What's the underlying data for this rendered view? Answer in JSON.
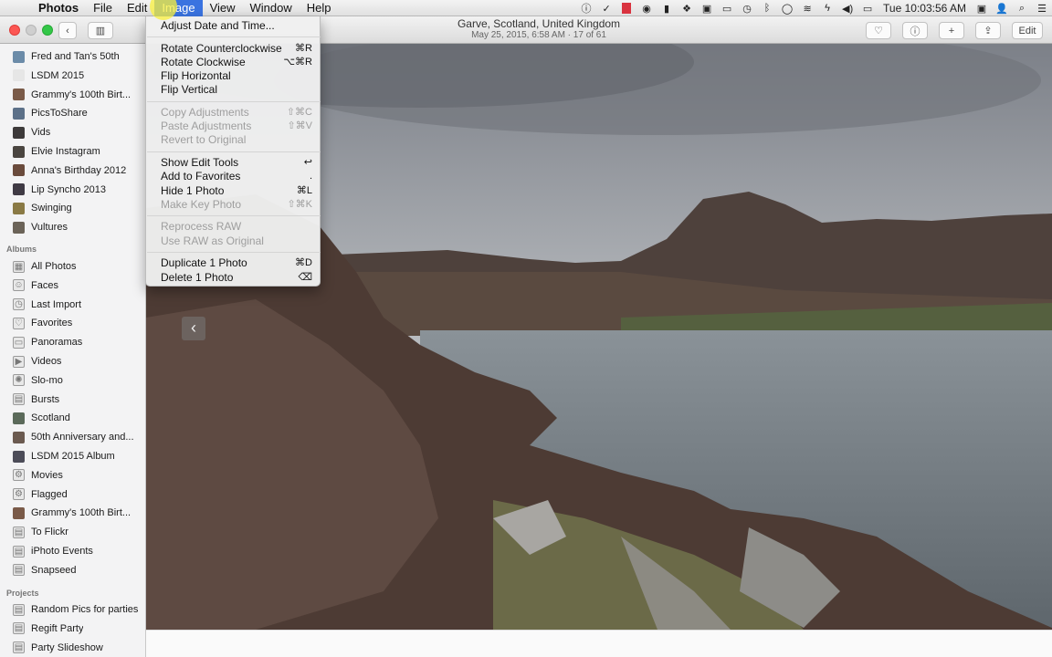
{
  "menubar": {
    "app": "Photos",
    "menus": [
      "File",
      "Edit",
      "Image",
      "View",
      "Window",
      "Help"
    ],
    "active_menu": "Image",
    "clock": "Tue 10:03:56 AM"
  },
  "window": {
    "title": "Garve, Scotland, United Kingdom",
    "subtitle": "May 25, 2015, 6:58 AM  ·  17 of 61",
    "edit_label": "Edit"
  },
  "image_menu": [
    {
      "label": "Adjust Date and Time...",
      "shortcut": "",
      "enabled": true
    },
    {
      "sep": true
    },
    {
      "label": "Rotate Counterclockwise",
      "shortcut": "⌘R",
      "enabled": true
    },
    {
      "label": "Rotate Clockwise",
      "shortcut": "⌥⌘R",
      "enabled": true
    },
    {
      "label": "Flip Horizontal",
      "shortcut": "",
      "enabled": true
    },
    {
      "label": "Flip Vertical",
      "shortcut": "",
      "enabled": true
    },
    {
      "sep": true
    },
    {
      "label": "Copy Adjustments",
      "shortcut": "⇧⌘C",
      "enabled": false
    },
    {
      "label": "Paste Adjustments",
      "shortcut": "⇧⌘V",
      "enabled": false
    },
    {
      "label": "Revert to Original",
      "shortcut": "",
      "enabled": false
    },
    {
      "sep": true
    },
    {
      "label": "Show Edit Tools",
      "shortcut": "↩",
      "enabled": true
    },
    {
      "label": "Add to Favorites",
      "shortcut": ".",
      "enabled": true
    },
    {
      "label": "Hide 1 Photo",
      "shortcut": "⌘L",
      "enabled": true
    },
    {
      "label": "Make Key Photo",
      "shortcut": "⇧⌘K",
      "enabled": false
    },
    {
      "sep": true
    },
    {
      "label": "Reprocess RAW",
      "shortcut": "",
      "enabled": false
    },
    {
      "label": "Use RAW as Original",
      "shortcut": "",
      "enabled": false
    },
    {
      "sep": true
    },
    {
      "label": "Duplicate 1 Photo",
      "shortcut": "⌘D",
      "enabled": true
    },
    {
      "label": "Delete 1 Photo",
      "shortcut": "⌫",
      "enabled": true
    }
  ],
  "sidebar": {
    "top_items": [
      {
        "label": "Fred and Tan's 50th",
        "thumb": "#6b8ba8"
      },
      {
        "label": "LSDM 2015",
        "thumb": "#e6e6e6"
      },
      {
        "label": "Grammy's 100th Birt...",
        "thumb": "#7a5a48"
      },
      {
        "label": "PicsToShare",
        "thumb": "#5c7088"
      },
      {
        "label": "Vids",
        "thumb": "#3d3a3a"
      },
      {
        "label": "Elvie Instagram",
        "thumb": "#4a4540"
      },
      {
        "label": "Anna's Birthday 2012",
        "thumb": "#6a4b3c"
      },
      {
        "label": "Lip Syncho 2013",
        "thumb": "#3f3a44"
      },
      {
        "label": "Swinging",
        "thumb": "#8a7a45"
      },
      {
        "label": "Vultures",
        "thumb": "#6b6358"
      }
    ],
    "albums_heading": "Albums",
    "albums": [
      {
        "label": "All Photos",
        "icon": "▦"
      },
      {
        "label": "Faces",
        "icon": "☺"
      },
      {
        "label": "Last Import",
        "icon": "◷"
      },
      {
        "label": "Favorites",
        "icon": "♡"
      },
      {
        "label": "Panoramas",
        "icon": "▭"
      },
      {
        "label": "Videos",
        "icon": "▶"
      },
      {
        "label": "Slo-mo",
        "icon": "✺"
      },
      {
        "label": "Bursts",
        "icon": "▤"
      },
      {
        "label": "Scotland",
        "thumb": "#5b6a5a"
      },
      {
        "label": "50th Anniversary and...",
        "thumb": "#6b5a50"
      },
      {
        "label": "LSDM 2015 Album",
        "thumb": "#4c4c58"
      },
      {
        "label": "Movies",
        "icon": "⚙"
      },
      {
        "label": "Flagged",
        "icon": "⚙"
      },
      {
        "label": "Grammy's 100th Birt...",
        "thumb": "#7a5a48"
      },
      {
        "label": "To Flickr",
        "icon": "▤"
      },
      {
        "label": "iPhoto Events",
        "icon": "▤"
      },
      {
        "label": "Snapseed",
        "icon": "▤"
      }
    ],
    "projects_heading": "Projects",
    "projects": [
      {
        "label": "Random Pics for parties",
        "icon": "▤"
      },
      {
        "label": "Regift Party",
        "icon": "▤"
      },
      {
        "label": "Party Slideshow",
        "icon": "▤"
      }
    ]
  }
}
